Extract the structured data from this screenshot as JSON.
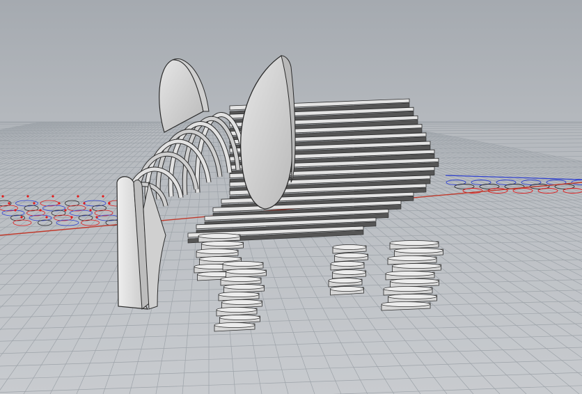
{
  "viewport": {
    "label": "",
    "display_mode": "shaded",
    "view": "perspective"
  },
  "scene": {
    "model": "elephant-slice-model",
    "background_top": "#a9aeb4",
    "background_bottom": "#c3c6ca",
    "grid_color": "#9da3a9",
    "x_axis_color": "#c0392b",
    "y_axis_color": "#2d3fd0",
    "slice_face_color": "#dedede",
    "slice_edge_color": "#2b2b2b",
    "highlight_color": "#e11b1b"
  }
}
